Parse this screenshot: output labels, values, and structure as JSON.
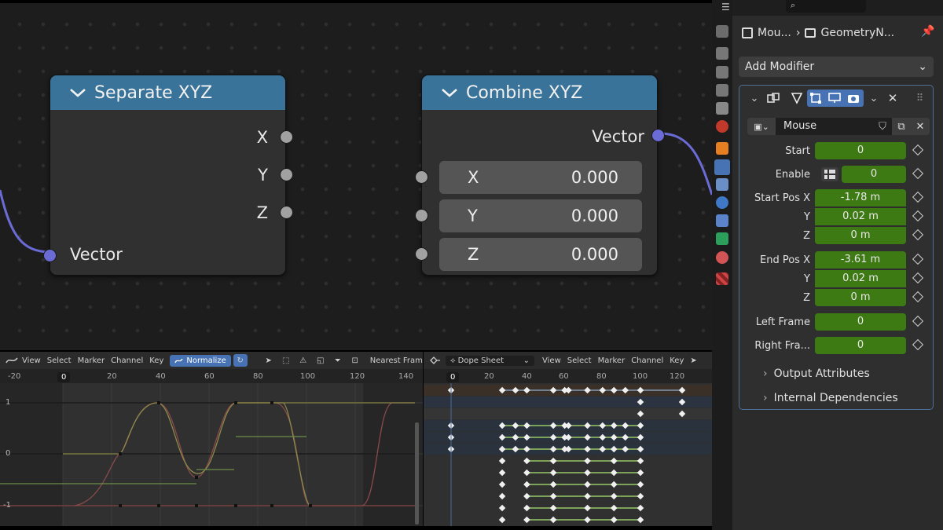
{
  "colors": {
    "node_header": "#3a7399",
    "socket_vector": "#6b6bd6",
    "socket_float": "#a1a1a1",
    "field_green": "#3e7a14",
    "accent_blue": "#4772b3"
  },
  "nodes": {
    "separate": {
      "title": "Separate XYZ",
      "outputs": [
        "X",
        "Y",
        "Z"
      ],
      "input": "Vector"
    },
    "combine": {
      "title": "Combine XYZ",
      "output": "Vector",
      "inputs": [
        {
          "label": "X",
          "value": "0.000"
        },
        {
          "label": "Y",
          "value": "0.000"
        },
        {
          "label": "Z",
          "value": "0.000"
        }
      ]
    }
  },
  "graph_editor": {
    "menus": [
      "View",
      "Select",
      "Marker",
      "Channel",
      "Key"
    ],
    "normalize_label": "Normalize",
    "snap_label": "Nearest Fram",
    "ruler": [
      "-20",
      "0",
      "20",
      "40",
      "60",
      "80",
      "100",
      "120",
      "140"
    ],
    "current_frame": "0",
    "y_labels": [
      "1",
      "0",
      "-1"
    ]
  },
  "dope_sheet": {
    "mode": "Dope Sheet",
    "menus": [
      "View",
      "Select",
      "Marker",
      "Channel",
      "Key"
    ],
    "ruler": [
      "0",
      "20",
      "40",
      "60",
      "80",
      "100",
      "120"
    ]
  },
  "properties": {
    "breadcrumb": {
      "object": "Mou...",
      "modifier": "GeometryN..."
    },
    "add_modifier": "Add Modifier",
    "modifier": {
      "node_group": "Mouse",
      "params": [
        {
          "label": "Start",
          "value": "0"
        },
        {
          "label": "Enable",
          "value": "0"
        },
        {
          "label": "Start Pos X",
          "value": "-1.78 m"
        },
        {
          "label": "Y",
          "value": "0.02 m"
        },
        {
          "label": "Z",
          "value": "0 m"
        },
        {
          "label": "End Pos X",
          "value": "-3.61 m"
        },
        {
          "label": "Y",
          "value": "0.02 m"
        },
        {
          "label": "Z",
          "value": "0 m"
        },
        {
          "label": "Left Frame",
          "value": "0"
        },
        {
          "label": "Right Fra...",
          "value": "0"
        }
      ],
      "subpanels": [
        "Output Attributes",
        "Internal Dependencies"
      ]
    }
  }
}
